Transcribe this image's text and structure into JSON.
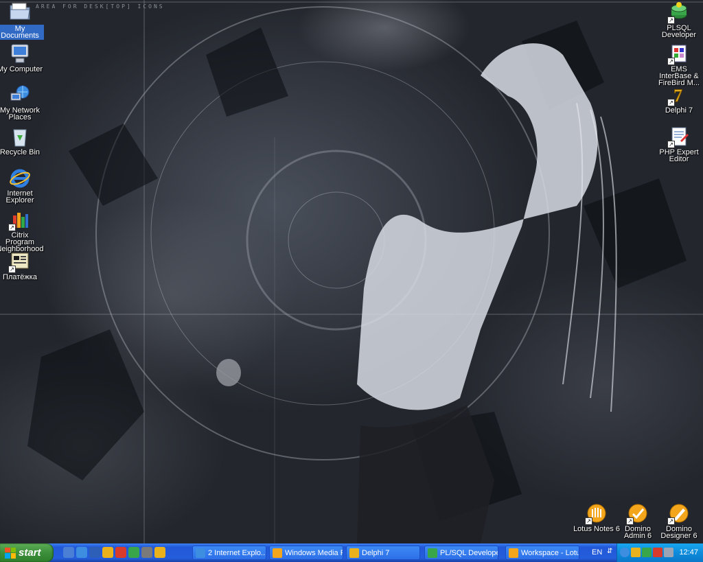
{
  "wallpaper": {
    "label": "AREA FOR DESK[TOP] ICONS"
  },
  "desktop_left": [
    {
      "name": "my-documents",
      "label": "My Documents",
      "icon": "folder-icon",
      "selected": true
    },
    {
      "name": "my-computer",
      "label": "My Computer",
      "icon": "computer-icon"
    },
    {
      "name": "my-network-places",
      "label": "My Network Places",
      "icon": "network-icon"
    },
    {
      "name": "recycle-bin",
      "label": "Recycle Bin",
      "icon": "recycle-bin-icon"
    },
    {
      "name": "internet-explorer",
      "label": "Internet Explorer",
      "icon": "ie-icon"
    },
    {
      "name": "citrix",
      "label": "Citrix Program Neighborhood",
      "icon": "citrix-icon"
    },
    {
      "name": "platezhka",
      "label": "Платёжка",
      "icon": "app-icon"
    }
  ],
  "desktop_right": [
    {
      "name": "plsql-developer",
      "label": "PLSQL Developer",
      "icon": "plsql-icon"
    },
    {
      "name": "ems-interbase",
      "label": "EMS InterBase & FireBird M...",
      "icon": "ems-icon"
    },
    {
      "name": "delphi-7",
      "label": "Delphi 7",
      "icon": "delphi-icon"
    },
    {
      "name": "php-expert-editor",
      "label": "PHP Expert Editor",
      "icon": "php-editor-icon"
    }
  ],
  "desktop_bottom": [
    {
      "name": "lotus-notes-6",
      "label": "Lotus Notes 6",
      "icon": "lotus-notes-icon"
    },
    {
      "name": "domino-admin-6",
      "label": "Domino Admin 6",
      "icon": "domino-admin-icon"
    },
    {
      "name": "domino-designer-6",
      "label": "Domino Designer 6",
      "icon": "domino-designer-icon"
    }
  ],
  "taskbar": {
    "start_label": "start",
    "quick_launch": [
      "show-desktop-icon",
      "ie-icon",
      "outlook-icon",
      "app-icon",
      "delphi-icon",
      "app-icon",
      "app-icon",
      "chrome-icon"
    ],
    "tasks": [
      {
        "label": "2 Internet Explo...",
        "icon": "ie-icon",
        "grouped": true
      },
      {
        "label": "Windows Media Pl...",
        "icon": "media-player-icon"
      },
      {
        "label": "Delphi 7",
        "icon": "delphi-icon"
      },
      {
        "label": "PL/SQL Developer...",
        "icon": "plsql-icon"
      },
      {
        "label": "Workspace - Lotu...",
        "icon": "lotus-notes-icon"
      }
    ],
    "language": "EN",
    "clock": "12:47"
  },
  "colors": {
    "taskbar": "#245edc",
    "start": "#3c8f3b",
    "tray": "#0e8bdb",
    "selection": "#316ac5"
  }
}
